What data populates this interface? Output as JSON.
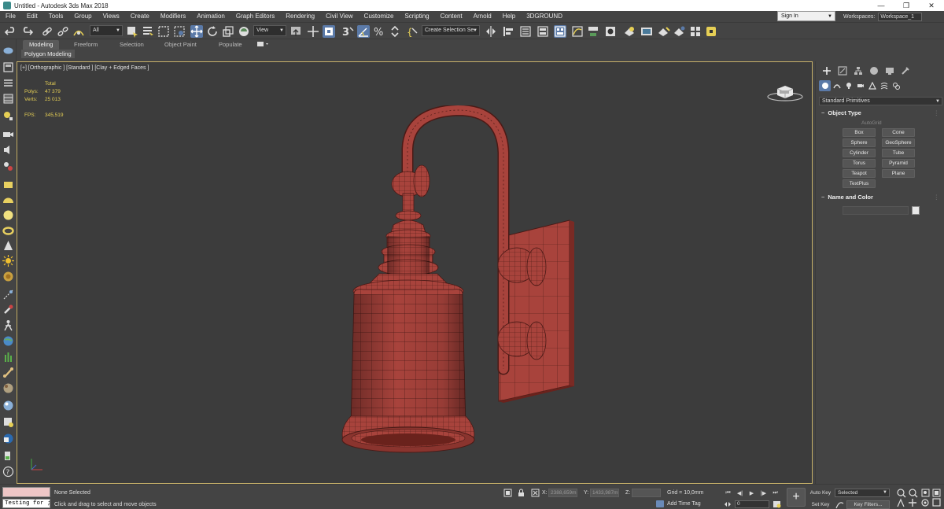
{
  "window": {
    "title": "Untitled - Autodesk 3ds Max 2018",
    "minimize": "—",
    "maximize": "❐",
    "close": "✕"
  },
  "menu": [
    "File",
    "Edit",
    "Tools",
    "Group",
    "Views",
    "Create",
    "Modifiers",
    "Animation",
    "Graph Editors",
    "Rendering",
    "Civil View",
    "Customize",
    "Scripting",
    "Content",
    "Arnold",
    "Help",
    "3DGROUND"
  ],
  "account": {
    "sign_in": "Sign In",
    "workspaces_label": "Workspaces:",
    "workspace_value": "Workspace_1"
  },
  "toolbar": {
    "selection_filter": "All",
    "reference_coord": "View",
    "named_selection_placeholder": "Create Selection Se"
  },
  "ribbon": {
    "tabs": [
      "Modeling",
      "Freeform",
      "Selection",
      "Object Paint",
      "Populate"
    ],
    "active_tab": "Modeling",
    "subtab": "Polygon Modeling"
  },
  "viewport": {
    "label": "[+] [Orthographic ] [Standard ] [Clay + Edged Faces ]",
    "stats": {
      "header": "Total",
      "polys_label": "Polys:",
      "polys_value": "47 379",
      "verts_label": "Verts:",
      "verts_value": "25 013",
      "fps_label": "FPS:",
      "fps_value": "345,519"
    },
    "model_color": "#a8433c"
  },
  "command_panel": {
    "category": "Standard Primitives",
    "object_type": {
      "title": "Object Type",
      "autogrid": "AutoGrid",
      "buttons": [
        "Box",
        "Cone",
        "Sphere",
        "GeoSphere",
        "Cylinder",
        "Tube",
        "Torus",
        "Pyramid",
        "Teapot",
        "Plane",
        "TextPlus"
      ]
    },
    "name_and_color": {
      "title": "Name and Color",
      "swatch_color": "#e8e8e8"
    }
  },
  "status": {
    "selection": "None Selected",
    "prompt": "Click and drag to select and move objects",
    "script_text": "Testing for ;",
    "x_label": "X:",
    "x_value": "2388,659m",
    "y_label": "Y:",
    "y_value": "1433,987m",
    "z_label": "Z:",
    "z_value": "",
    "grid": "Grid = 10,0mm",
    "add_time_tag": "Add Time Tag",
    "frame": "0",
    "auto_key": "Auto Key",
    "set_key": "Set Key",
    "key_mode": "Selected",
    "key_filters": "Key Filters..."
  },
  "accent": {
    "active_icon": "#5b7aa8",
    "viewport_border": "#c8b26a",
    "stats_text": "#e6cf55"
  }
}
